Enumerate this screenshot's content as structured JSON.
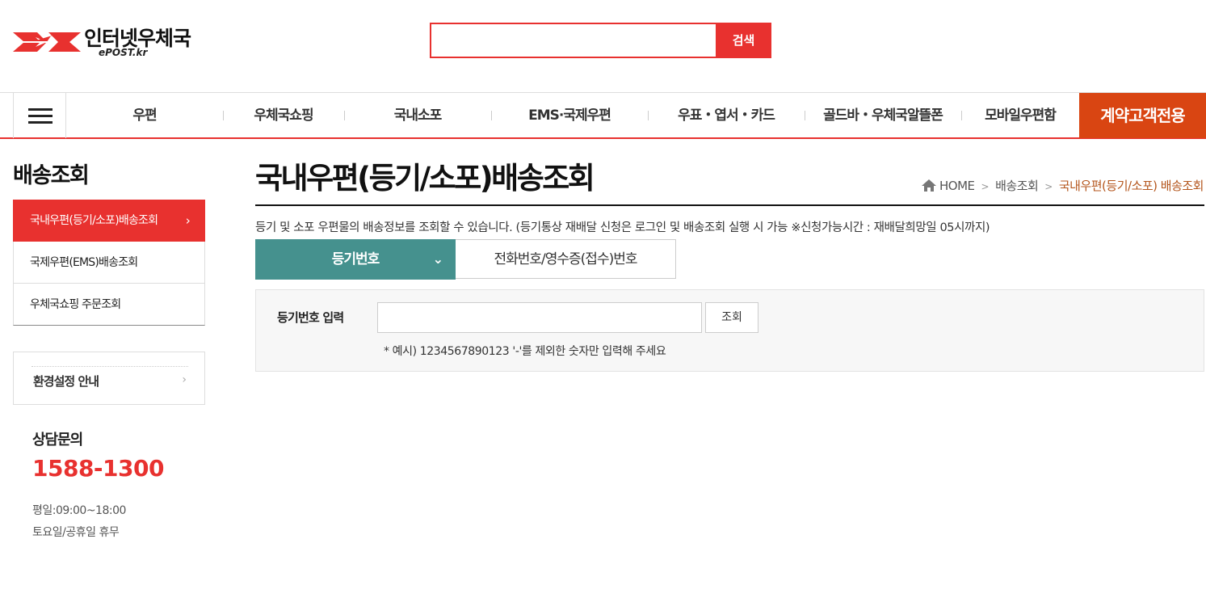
{
  "header": {
    "logo_text": "인터넷우체국",
    "logo_sub": "ePOST.kr",
    "search_placeholder": "",
    "search_button": "검색"
  },
  "gnb": {
    "items": [
      "우편",
      "우체국쇼핑",
      "국내소포",
      "EMS·국제우편",
      "우표・엽서・카드",
      "골드바・우체국알뜰폰",
      "모바일우편함"
    ],
    "special": "계약고객전용"
  },
  "sidebar": {
    "title": "배송조회",
    "items": [
      {
        "label": "국내우편(등기/소포)배송조회",
        "active": true
      },
      {
        "label": "국제우편(EMS)배송조회",
        "active": false
      },
      {
        "label": "우체국쇼핑 주문조회",
        "active": false
      }
    ],
    "env_label": "환경설정 안내",
    "cs_title": "상담문의",
    "cs_phone": "1588-1300",
    "cs_weekday": "평일:09:00~18:00",
    "cs_weekend": "토요일/공휴일 휴무"
  },
  "main": {
    "title": "국내우편(등기/소포)배송조회",
    "breadcrumb": [
      "HOME",
      "배송조회",
      "국내우편(등기/소포) 배송조회"
    ],
    "description": "등기 및 소포 우편물의 배송정보를 조회할 수 있습니다. (등기통상 재배달 신청은 로그인 및 배송조회 실행 시 가능 ※신청가능시간 : 재배달희망일 05시까지)",
    "tabs": [
      {
        "label": "등기번호",
        "active": true
      },
      {
        "label": "전화번호/영수증(접수)번호",
        "active": false
      }
    ],
    "form": {
      "label": "등기번호 입력",
      "input_value": "",
      "button": "조회",
      "hint": "* 예시) 1234567890123 '-'를 제외한 숫자만 입력해 주세요"
    }
  },
  "colors": {
    "brand_red": "#e8312f",
    "special_orange": "#d94512",
    "tab_teal": "#45918e",
    "breadcrumb_current": "#b4561d"
  }
}
